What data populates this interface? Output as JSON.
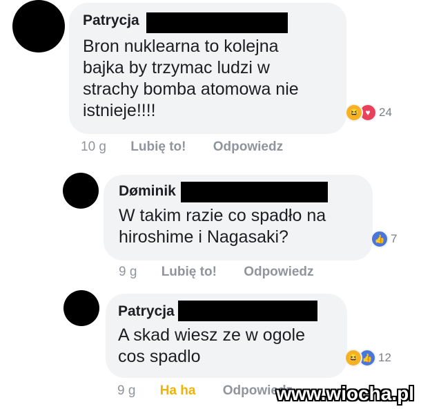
{
  "comments": [
    {
      "author": "Patrycja",
      "text": "Bron nuklearna to kolejna\nbajka by trzymac ludzi w\nstrachy bomba atomowa nie\nistnieje!!!!",
      "reaction_count": "24",
      "reaction_icons": [
        "haha-reaction-icon",
        "love-reaction-icon"
      ],
      "time": "10 g",
      "like_label": "Lubię to!",
      "reply_label": "Odpowiedz"
    },
    {
      "author": "Døminik",
      "text": "W takim razie co spadło na\nhiroshime i Nagasaki?",
      "reaction_count": "7",
      "reaction_icons": [
        "like-reaction-icon"
      ],
      "time": "9 g",
      "like_label": "Lubię to!",
      "reply_label": "Odpowiedz"
    },
    {
      "author": "Patrycja",
      "text": "A skad wiesz ze w ogole\ncos spadlo",
      "reaction_count": "12",
      "reaction_icons": [
        "haha-reaction-icon",
        "like-reaction-icon"
      ],
      "time": "9 g",
      "like_label": "Ha ha",
      "reply_label": "Odpowiedz"
    }
  ],
  "icons": {
    "haha": "😆",
    "love": "♥",
    "like": "👍"
  },
  "colors": {
    "bubble": "#f2f3f5",
    "meta": "#90949c",
    "haha_active": "#f0b400",
    "love": "#e8415b",
    "like": "#4a76d9"
  },
  "watermark": "www.wiocha.pl"
}
